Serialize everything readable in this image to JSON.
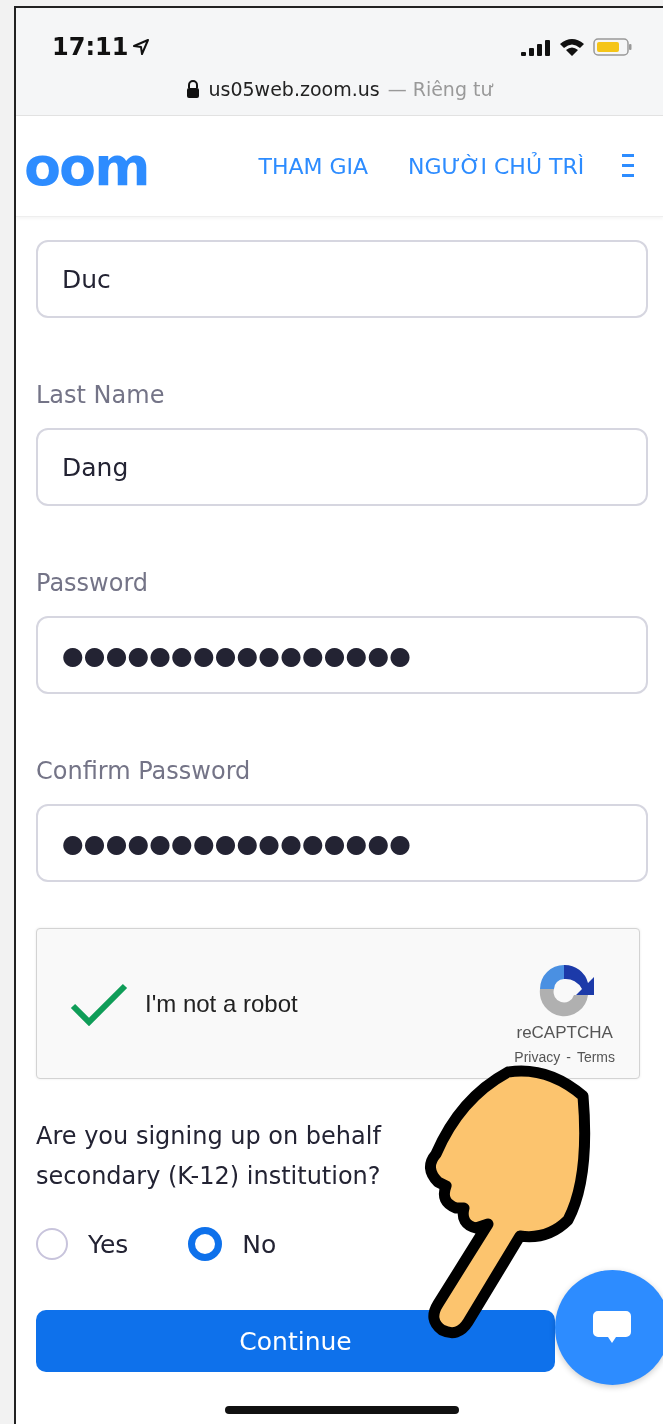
{
  "status_bar": {
    "time": "17:11"
  },
  "address_bar": {
    "domain": "us05web.zoom.us",
    "suffix": "— Riêng tư"
  },
  "header": {
    "logo": "oom",
    "nav": [
      {
        "label": "THAM GIA"
      },
      {
        "label": "NGƯỜI CHỦ TRÌ"
      }
    ]
  },
  "fields": [
    {
      "value": "Duc"
    },
    {
      "label": "Last Name",
      "value": "Dang"
    },
    {
      "label": "Password",
      "value": "●●●●●●●●●●●●●●●●"
    },
    {
      "label": "Confirm Password",
      "value": "●●●●●●●●●●●●●●●●"
    }
  ],
  "captcha": {
    "checked": true,
    "label": "I'm not a robot",
    "brand": "reCAPTCHA",
    "privacy": "Privacy",
    "separator": "-",
    "terms": "Terms"
  },
  "question": {
    "lines": [
      "Are you signing up on behalf",
      "secondary (K-12) institution?"
    ]
  },
  "options": [
    {
      "label": "Yes",
      "selected": false
    },
    {
      "label": "No",
      "selected": true
    }
  ],
  "continue_button": "Continue"
}
